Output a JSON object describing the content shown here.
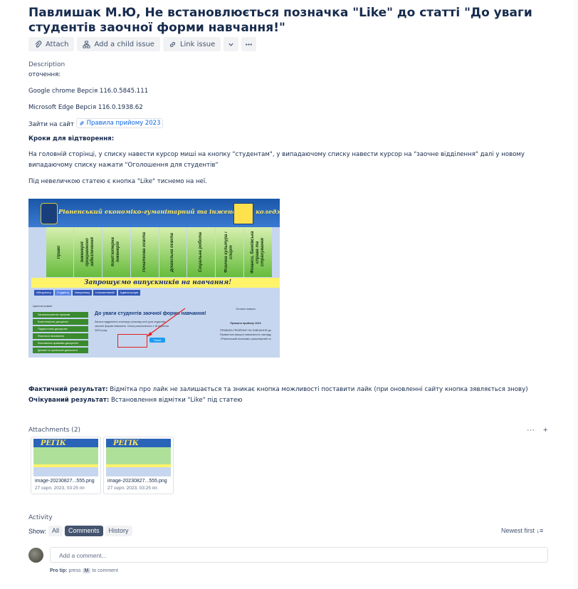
{
  "issue": {
    "title": "Павлишак М.Ю, Не встановлюється позначка \"Like\" до статті \"До уваги студентів заочної форми навчання!\""
  },
  "toolbar": {
    "attach": "Attach",
    "add_child": "Add a child issue",
    "link_issue": "Link issue"
  },
  "description": {
    "label": "Description",
    "env_label": "оточення:",
    "browser1": "Google chrome Версія 116.0.5845.111",
    "browser2": "Microsoft Edge Версія 116.0.1938.62",
    "goto_prefix": "Зайти на сайт",
    "goto_link": "Правила прийому 2023",
    "steps_heading": "Кроки для відтворення:",
    "step1": "На головній сторінці, у списку навести курсор миші на кнопку \"студентам\", у випадаючому списку навести курсор на \"заочне відділення\" далі у новому випадаючому списку нажати \"Оголошення для студентів\"",
    "step2": "Під невеличкою статею є кнопка \"Like\" тиснемо на неї.",
    "actual_label": "Фактичний результат:",
    "actual_text": "Відмітка про лайк не залишається та зникає кнопка можливості поставити лайк (при оновленні сайту кнопка зявляється знову)",
    "expected_label": "Очікуваний результат:",
    "expected_text": "Встановлення відмітки \"Like\" під статею"
  },
  "screenshot": {
    "banner_text": "Рівненський економіко-гуманітарний та інженерний коледж",
    "columns": [
      "Право",
      "Інженерія програмного забезпечення",
      "Комп'ютерна інженерія",
      "Початкова освіта",
      "Дошкільна освіта",
      "Соціальна робота",
      "Фізична культура і спорт",
      "Фінанси, банківська справа та страхування"
    ],
    "welcome": "Запрошуємо випускників на навчання!",
    "nav": [
      "Абітурієнту",
      "Студенту",
      "Випускнику",
      "Інтерактивний",
      "Адміністрація"
    ],
    "menu_heading": "Циклові комісії",
    "menu": [
      "Загальноосвітніх програм",
      "Комп'ютерних дисциплін",
      "Педагогічних дисциплін",
      "Фізичного виховання",
      "Економічно-правових дисциплін",
      "Ділової та суспільної діяльності"
    ],
    "article_title": "До уваги студентів заочної форми навчання!",
    "article_text": "Заочне відділення оголошує розклад сесії для студентів заочної форми навчання. Сесія розпочнеться з 18 вересня 2023 року.",
    "tweet": "Tweet",
    "right_col": [
      "Останні новини",
      "Правила прийому 2023",
      "ПРАВИЛА ПРИЙОМУ НА НАВЧАННЯ до Приватного вищого навчального закладу «Рівненський економіко-гуманітарний та"
    ]
  },
  "attachments": {
    "label": "Attachments (2)",
    "more": "···",
    "add": "+",
    "items": [
      {
        "name": "image-20230827...555.png",
        "date": "27 серп. 2023, 03:25 пп",
        "thumb_text": "РЕГІК"
      },
      {
        "name": "image-20230827...555.png",
        "date": "27 серп. 2023, 03:25 пп",
        "thumb_text": "РЕГІК"
      }
    ]
  },
  "activity": {
    "label": "Activity",
    "show": "Show:",
    "filters": [
      "All",
      "Comments",
      "History"
    ],
    "selected": "Comments",
    "sort": "Newest first ↓≡",
    "comment_placeholder": "Add a comment...",
    "tip_label": "Pro tip:",
    "tip_press": "press",
    "tip_key": "M",
    "tip_rest": "to comment"
  }
}
